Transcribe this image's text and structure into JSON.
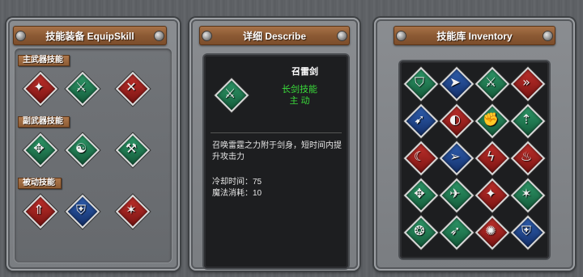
{
  "equip": {
    "title": "技能装备 EquipSkill",
    "primary_label": "主武器技能",
    "secondary_label": "副武器技能",
    "passive_label": "被动技能",
    "primary": [
      {
        "icon": "dragon-slash-icon",
        "color": "red",
        "glyph": "✦"
      },
      {
        "icon": "thunder-sword-icon",
        "color": "green",
        "glyph": "⚔"
      },
      {
        "icon": "cross-blades-icon",
        "color": "red",
        "glyph": "✕"
      }
    ],
    "secondary": [
      {
        "icon": "winged-sword-icon",
        "color": "green",
        "glyph": "✥"
      },
      {
        "icon": "meditation-icon",
        "color": "green",
        "glyph": "☯"
      },
      {
        "icon": "axe-icon",
        "color": "green",
        "glyph": "⚒"
      }
    ],
    "passive": [
      {
        "icon": "sword-chevron-icon",
        "color": "red",
        "glyph": "⇑"
      },
      {
        "icon": "shield-icon",
        "color": "blue",
        "glyph": "⛨"
      },
      {
        "icon": "sword-star-icon",
        "color": "red",
        "glyph": "✶"
      }
    ]
  },
  "describe": {
    "title": "详细 Describe",
    "skill_name": "召雷剑",
    "skill_icon": "thunder-sword-icon",
    "skill_type": "长剑技能",
    "skill_mode": "主 动",
    "description": "召唤雷霆之力附于剑身，短时间内提升攻击力",
    "cooldown": "冷却时间：75",
    "mana": "魔法消耗：10"
  },
  "inventory": {
    "title": "技能库 Inventory",
    "items": [
      {
        "icon": "sword-shield-icon",
        "color": "green",
        "glyph": "⛉"
      },
      {
        "icon": "dash-kick-icon",
        "color": "blue",
        "glyph": "➤"
      },
      {
        "icon": "thunder-sword-icon",
        "color": "green",
        "glyph": "⚔"
      },
      {
        "icon": "speed-boots-icon",
        "color": "red",
        "glyph": "»"
      },
      {
        "icon": "charge-icon",
        "color": "blue",
        "glyph": "➹"
      },
      {
        "icon": "whirl-slash-icon",
        "color": "red",
        "glyph": "◐"
      },
      {
        "icon": "fist-icon",
        "color": "green",
        "glyph": "✊"
      },
      {
        "icon": "spear-icon",
        "color": "green",
        "glyph": "⇡"
      },
      {
        "icon": "crescent-slash-icon",
        "color": "red",
        "glyph": "☾"
      },
      {
        "icon": "arrow-strike-icon",
        "color": "blue",
        "glyph": "➢"
      },
      {
        "icon": "lightning-icon",
        "color": "red",
        "glyph": "ϟ"
      },
      {
        "icon": "flame-icon",
        "color": "red",
        "glyph": "♨"
      },
      {
        "icon": "winged-sword-icon",
        "color": "green",
        "glyph": "✥"
      },
      {
        "icon": "leap-attack-icon",
        "color": "green",
        "glyph": "✈"
      },
      {
        "icon": "dragon-slash-icon",
        "color": "red",
        "glyph": "✦"
      },
      {
        "icon": "warrior-stance-icon",
        "color": "green",
        "glyph": "✶"
      },
      {
        "icon": "swirl-icon",
        "color": "green",
        "glyph": "❂"
      },
      {
        "icon": "sprint-icon",
        "color": "green",
        "glyph": "➶"
      },
      {
        "icon": "burst-icon",
        "color": "red",
        "glyph": "✺"
      },
      {
        "icon": "guard-icon",
        "color": "blue",
        "glyph": "⛨"
      }
    ]
  }
}
